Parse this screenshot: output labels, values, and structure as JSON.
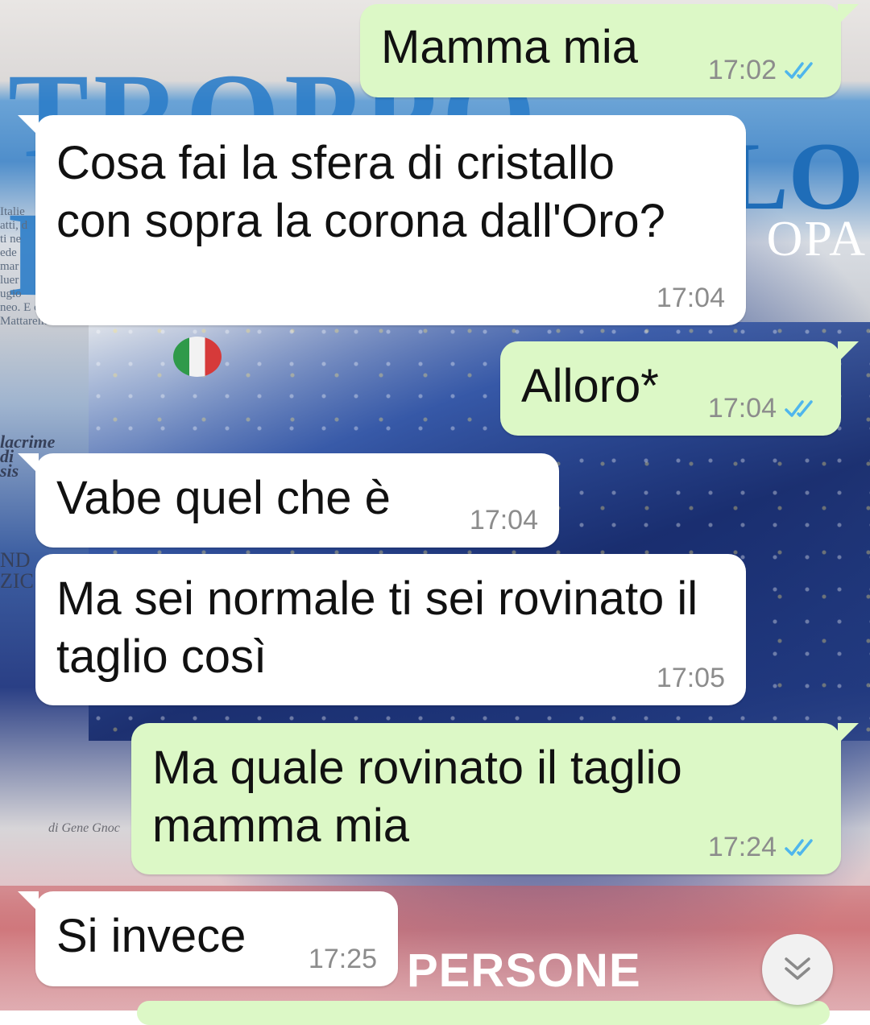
{
  "wallpaper": {
    "headline_left": "TROPPO BELLO",
    "headline_right": "LO",
    "headline_right_sub": "OPA",
    "column_text": "Italie\natti, d\nti ne\nede\nmar\nluer\nugio\nneo. E oggi\nMattarella",
    "side_text_1": "lacrime\ndi\nsis",
    "side_text_2": "ND\nZIC",
    "small_caption": "di Gene Gnoc",
    "bottom_word": "PERSONE"
  },
  "messages": [
    {
      "direction": "out",
      "text": "Mamma mia",
      "time": "17:02",
      "read": true
    },
    {
      "direction": "in",
      "text": "Cosa fai la sfera di cristallo\ncon sopra la corona dall'Oro?",
      "time": "17:04"
    },
    {
      "direction": "out",
      "text": "Alloro*",
      "time": "17:04",
      "read": true
    },
    {
      "direction": "in",
      "text": "Vabe quel che è",
      "time": "17:04"
    },
    {
      "direction": "in",
      "text": "Ma sei normale ti sei rovinato il\ntaglio così",
      "time": "17:05"
    },
    {
      "direction": "out",
      "text": "Ma quale rovinato il taglio\nmamma mia",
      "time": "17:24",
      "read": true
    },
    {
      "direction": "in",
      "text": "Si invece",
      "time": "17:25"
    }
  ],
  "colors": {
    "outgoing_bubble": "#dcf8c6",
    "incoming_bubble": "#ffffff",
    "read_ticks": "#4fb6ec",
    "timestamp": "#8c8c8c"
  },
  "icons": {
    "read_receipt": "double-check-icon",
    "scroll_down": "chevron-double-down-icon"
  }
}
